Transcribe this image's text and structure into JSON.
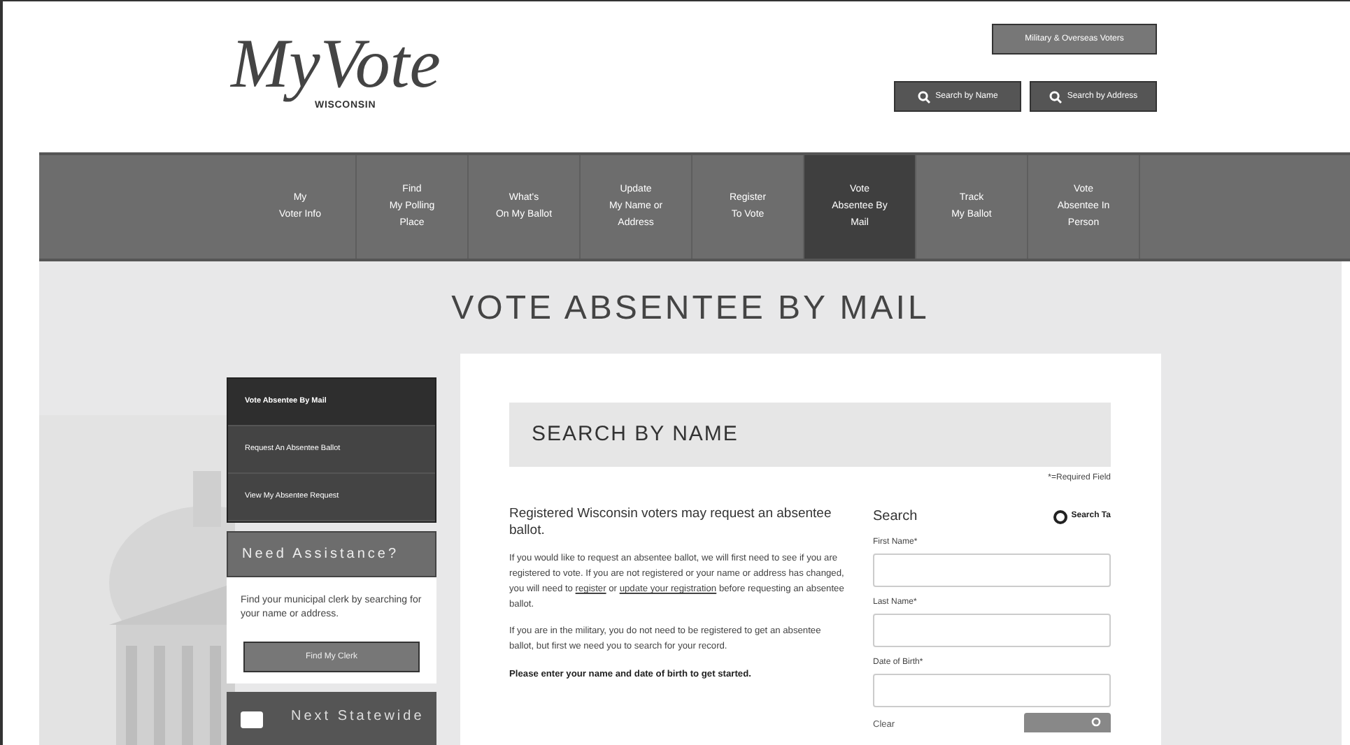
{
  "logo": {
    "script": "MyVote",
    "state": "WISCONSIN"
  },
  "header_buttons": [
    {
      "label": "Military & Overseas Voters",
      "kind": "plain"
    },
    {
      "label": "Search by Name",
      "kind": "search"
    },
    {
      "label": "Search by Address",
      "kind": "search"
    }
  ],
  "nav": [
    {
      "label": "My\nVoter Info",
      "selected": false
    },
    {
      "label": "Find\nMy Polling\nPlace",
      "selected": false
    },
    {
      "label": "What's\nOn My Ballot",
      "selected": false
    },
    {
      "label": "Update\nMy Name or\nAddress",
      "selected": false
    },
    {
      "label": "Register\nTo Vote",
      "selected": false
    },
    {
      "label": "Vote\nAbsentee By\nMail",
      "selected": true
    },
    {
      "label": "Track\nMy Ballot",
      "selected": false
    },
    {
      "label": "Vote\nAbsentee In\nPerson",
      "selected": false
    }
  ],
  "page_title": "VOTE ABSENTEE BY MAIL",
  "sidebar": {
    "items": [
      {
        "label": "Vote Absentee By Mail",
        "selected": true
      },
      {
        "label": "Request An Absentee Ballot",
        "selected": false
      },
      {
        "label": "View My Absentee Request",
        "selected": false
      }
    ],
    "assistance": {
      "title": "Need Assistance?",
      "text": "Find your municipal clerk by searching for your name or address.",
      "button": "Find My Clerk"
    },
    "next_box": {
      "title": "Next Statewide"
    }
  },
  "main": {
    "heading": "SEARCH BY NAME",
    "required_note": "*=Required Field",
    "intro": "Registered Wisconsin voters may request an absentee ballot.",
    "paragraph_1": {
      "before": "If you would like to request an absentee ballot, we will first need to see if you are registered to vote. If you are not registered or your name or address has changed, you will need to",
      "link_1": "register",
      "middle": "or",
      "link_2": "update your registration",
      "after": "before requesting an absentee ballot."
    },
    "paragraph_2": "If you are in the military, you do not need to be registered to get an absentee ballot, but first we need you to search for your record.",
    "prompt": "Please enter your name and date of birth to get started.",
    "form": {
      "title": "Search",
      "tips": "Search Ta",
      "fields": [
        {
          "label": "First Name*"
        },
        {
          "label": "Last Name*"
        },
        {
          "label": "Date of Birth*"
        }
      ],
      "clear": "Clear"
    }
  }
}
